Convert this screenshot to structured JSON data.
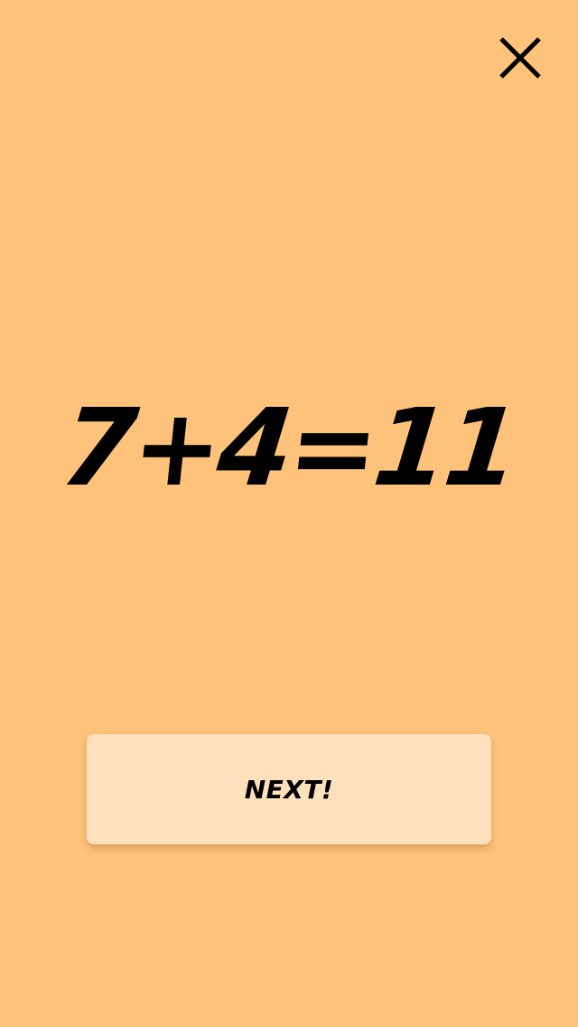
{
  "screen": {
    "background_color": "#FFC27A"
  },
  "header": {
    "close_icon": "close-icon"
  },
  "main": {
    "equation": "7+4=11"
  },
  "footer": {
    "next_label": "NEXT!",
    "button_color": "#FFE0BD"
  }
}
